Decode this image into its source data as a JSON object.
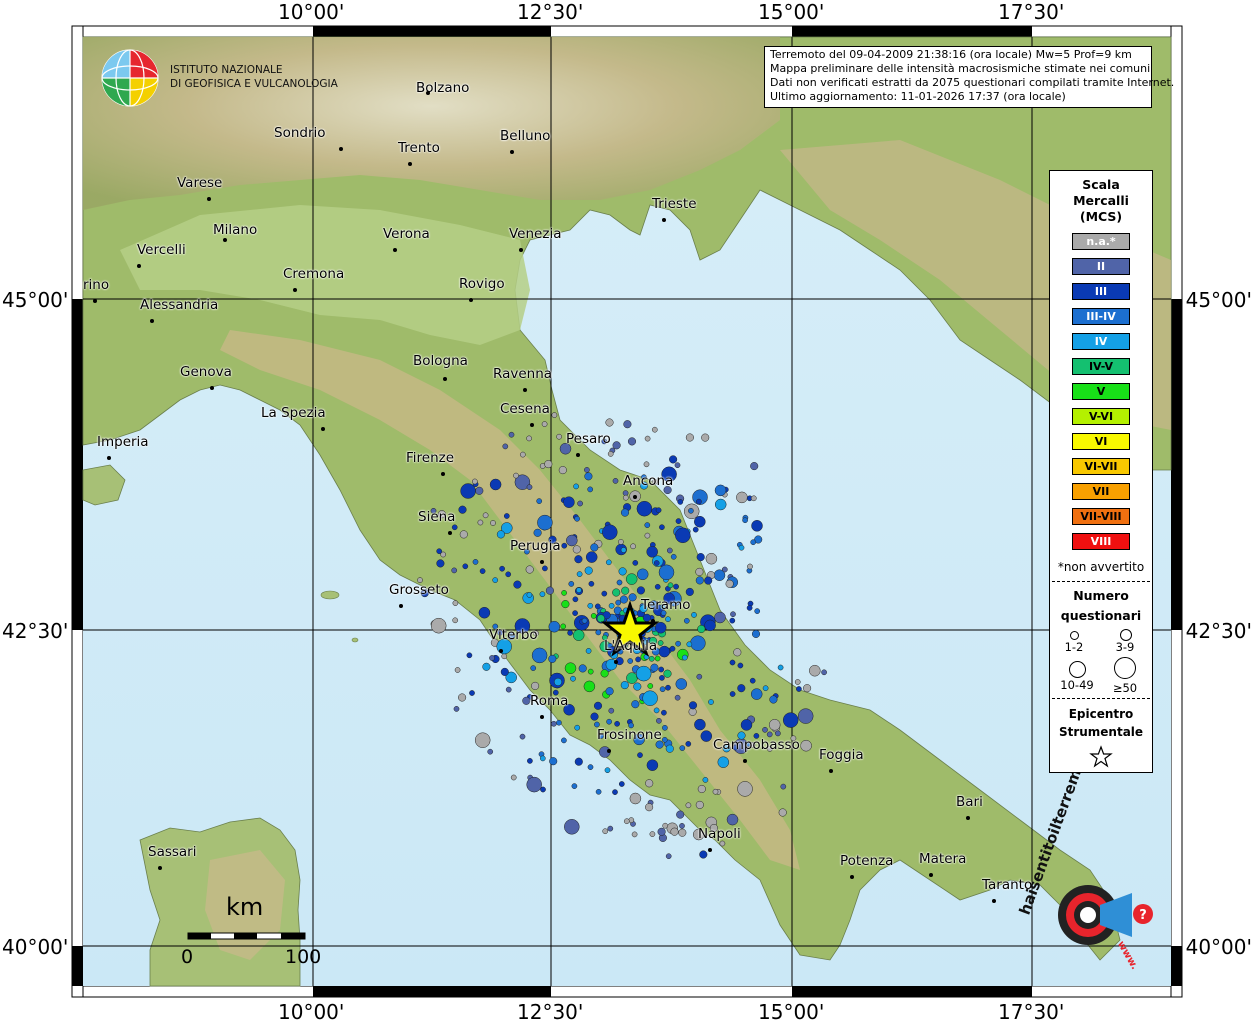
{
  "map": {
    "institute": {
      "line1": "ISTITUTO NAZIONALE",
      "line2": "DI GEOFISICA E VULCANOLOGIA"
    },
    "info": {
      "line1": "Terremoto del 09-04-2009 21:38:16 (ora locale) Mw=5 Prof=9 km",
      "line2": "Mappa preliminare delle intensità macrosismiche stimate nei comuni",
      "line3": "Dati non verificati estratti da 2075 questionari compilati tramite Internet.",
      "line4": "Ultimo aggiornamento: 11-01-2026 17:37 (ora locale)"
    },
    "lon_labels": [
      "10°00'",
      "12°30'",
      "15°00'",
      "17°30'"
    ],
    "lat_labels": [
      "45°00'",
      "42°30'",
      "40°00'"
    ],
    "cities": [
      {
        "name": "Bolzano"
      },
      {
        "name": "Sondrio"
      },
      {
        "name": "Trento"
      },
      {
        "name": "Belluno"
      },
      {
        "name": "Varese"
      },
      {
        "name": "Milano"
      },
      {
        "name": "Vercelli"
      },
      {
        "name": "Verona"
      },
      {
        "name": "Venezia"
      },
      {
        "name": "Trieste"
      },
      {
        "name": "Cremona"
      },
      {
        "name": "Rovigo"
      },
      {
        "name": "rino"
      },
      {
        "name": "Alessandria"
      },
      {
        "name": "Bologna"
      },
      {
        "name": "Ravenna"
      },
      {
        "name": "Genova"
      },
      {
        "name": "Cesena"
      },
      {
        "name": "La Spezia"
      },
      {
        "name": "Pesaro"
      },
      {
        "name": "Imperia"
      },
      {
        "name": "Firenze"
      },
      {
        "name": "Ancona"
      },
      {
        "name": "Siena"
      },
      {
        "name": "Perugia"
      },
      {
        "name": "Grosseto"
      },
      {
        "name": "Teramo"
      },
      {
        "name": "Viterbo"
      },
      {
        "name": "L'Aquila"
      },
      {
        "name": "Roma"
      },
      {
        "name": "Frosinone"
      },
      {
        "name": "Campobasso"
      },
      {
        "name": "Foggia"
      },
      {
        "name": "Bari"
      },
      {
        "name": "Napoli"
      },
      {
        "name": "Sassari"
      },
      {
        "name": "Potenza"
      },
      {
        "name": "Matera"
      },
      {
        "name": "Taranto"
      }
    ],
    "scale_bar": {
      "unit": "km",
      "min": "0",
      "max": "100"
    }
  },
  "legend": {
    "title1": "Scala",
    "title2": "Mercalli",
    "title3": "(MCS)",
    "items": [
      {
        "label": "n.a.*",
        "color": "#aaaaaa",
        "text_color": "#ffffff"
      },
      {
        "label": "II",
        "color": "#5064a8",
        "text_color": "#ffffff"
      },
      {
        "label": "III",
        "color": "#0a3ab4",
        "text_color": "#ffffff"
      },
      {
        "label": "III-IV",
        "color": "#1c6fd0",
        "text_color": "#ffffff"
      },
      {
        "label": "IV",
        "color": "#14a0e6",
        "text_color": "#ffffff"
      },
      {
        "label": "IV-V",
        "color": "#14c070",
        "text_color": "#000000"
      },
      {
        "label": "V",
        "color": "#18e018",
        "text_color": "#000000"
      },
      {
        "label": "V-VI",
        "color": "#b4f000",
        "text_color": "#000000"
      },
      {
        "label": "VI",
        "color": "#f8f800",
        "text_color": "#000000"
      },
      {
        "label": "VI-VII",
        "color": "#f8c800",
        "text_color": "#000000"
      },
      {
        "label": "VII",
        "color": "#f8a000",
        "text_color": "#000000"
      },
      {
        "label": "VII-VIII",
        "color": "#f07010",
        "text_color": "#000000"
      },
      {
        "label": "VIII",
        "color": "#f01010",
        "text_color": "#ffffff"
      }
    ],
    "note": "*non avvertito",
    "count_title1": "Numero",
    "count_title2": "questionari",
    "count_sizes": [
      "1-2",
      "3-9",
      "10-49",
      "≥50"
    ],
    "epicenter_title1": "Epicentro",
    "epicenter_title2": "Strumentale"
  },
  "watermark": {
    "text": "haisentitoilterremoto.it",
    "url": "www."
  },
  "epicenter": {
    "icon": "star-icon",
    "color": "#f8f800"
  }
}
